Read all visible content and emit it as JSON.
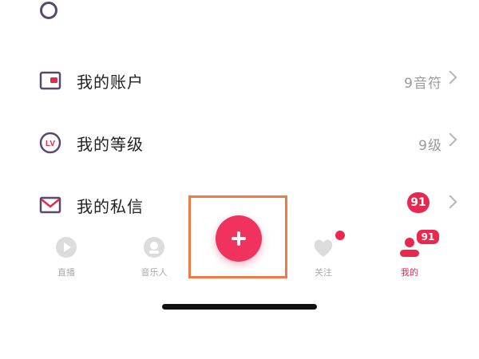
{
  "top_partial": {
    "label": ""
  },
  "menu": [
    {
      "key": "account",
      "label": "我的账户",
      "value": "9音符",
      "icon": "wallet-icon"
    },
    {
      "key": "level",
      "label": "我的等级",
      "value": "9级",
      "icon": "lv-badge-icon",
      "icon_text": "LV"
    },
    {
      "key": "messages",
      "label": "我的私信",
      "badge": "91",
      "icon": "mail-icon"
    }
  ],
  "tabbar": {
    "items": [
      {
        "key": "live",
        "label": "直播",
        "icon": "live-play-icon"
      },
      {
        "key": "musician",
        "label": "音乐人",
        "icon": "music-person-icon"
      },
      {
        "key": "follow",
        "label": "关注",
        "icon": "heart-icon",
        "dot": true
      },
      {
        "key": "me",
        "label": "我的",
        "icon": "user-icon",
        "badge": "91",
        "active": true
      }
    ],
    "fab_icon": "plus-icon"
  },
  "colors": {
    "accent": "#f0335e",
    "badge": "#e8284e",
    "highlight": "#f07a45",
    "icon_purple": "#5b4670"
  }
}
